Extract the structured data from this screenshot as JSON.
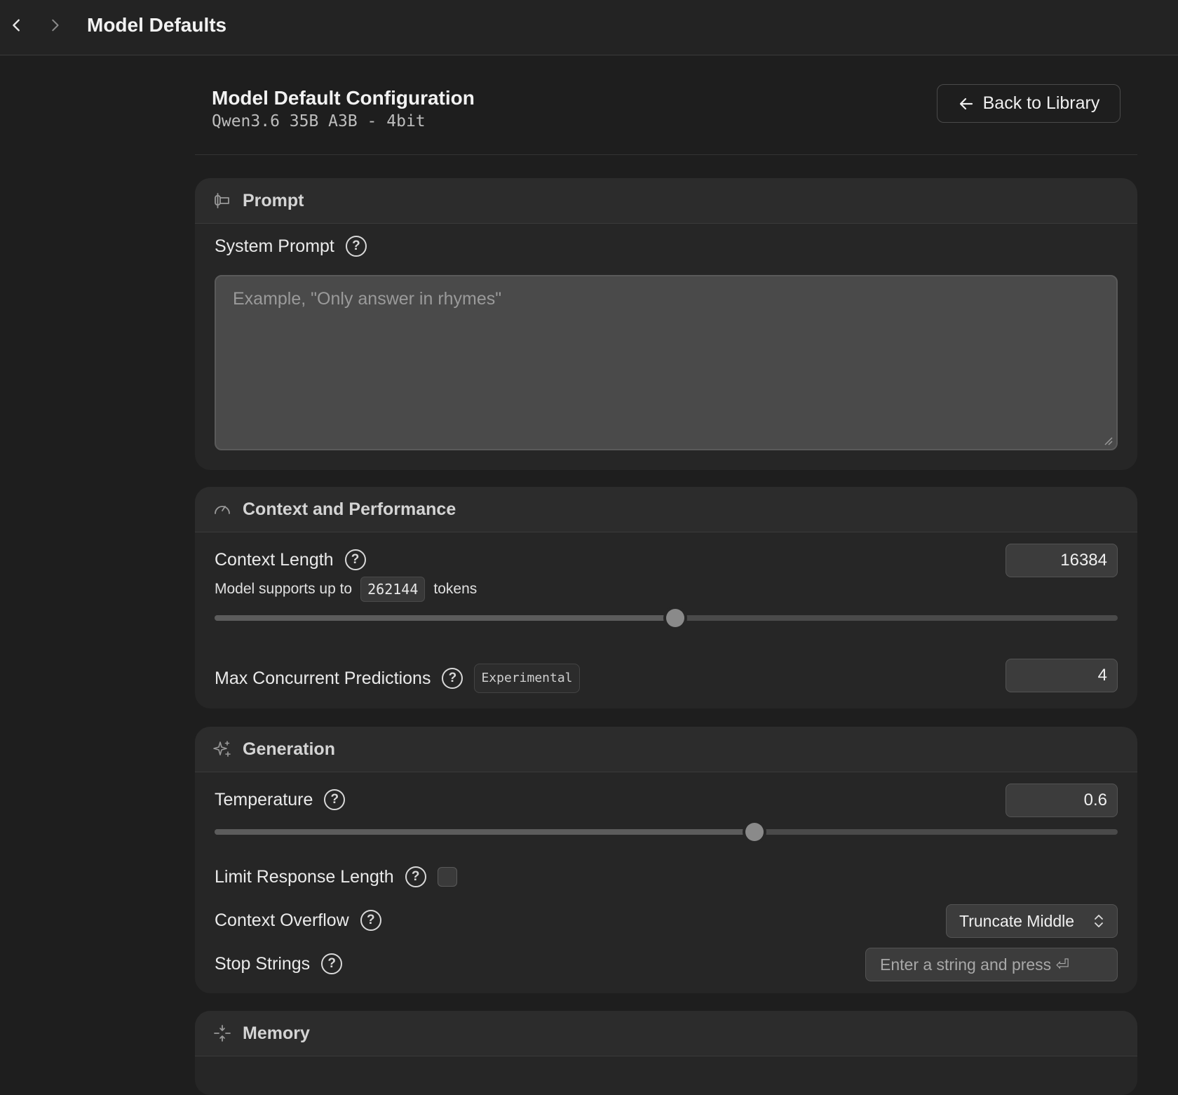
{
  "topbar": {
    "title": "Model Defaults",
    "back_icon": "chevron-left-icon",
    "forward_icon": "chevron-right-icon"
  },
  "header": {
    "title": "Model Default Configuration",
    "model": "Qwen3.6 35B A3B - 4bit",
    "back_button": "Back to Library"
  },
  "prompt_section": {
    "title": "Prompt",
    "system_prompt_label": "System Prompt",
    "system_prompt_value": "",
    "system_prompt_placeholder": "Example, \"Only answer in rhymes\""
  },
  "context_section": {
    "title": "Context and Performance",
    "context_length_label": "Context Length",
    "context_length_value": "16384",
    "supports_prefix": "Model supports up to",
    "supports_max": "262144",
    "supports_suffix": "tokens",
    "context_slider_fraction": 0.51,
    "max_concurrent_label": "Max Concurrent Predictions",
    "experimental_badge": "Experimental",
    "max_concurrent_value": "4"
  },
  "generation_section": {
    "title": "Generation",
    "temperature_label": "Temperature",
    "temperature_value": "0.6",
    "temperature_slider_fraction": 0.598,
    "limit_response_label": "Limit Response Length",
    "limit_response_checked": false,
    "context_overflow_label": "Context Overflow",
    "context_overflow_value": "Truncate Middle",
    "stop_strings_label": "Stop Strings",
    "stop_strings_placeholder": "Enter a string and press ⏎"
  },
  "memory_section": {
    "title": "Memory"
  },
  "colors": {
    "background": "#1e1e1e",
    "card": "#262626",
    "card_header": "#2c2c2c",
    "input": "#3c3c3c",
    "textarea": "#4a4a4a"
  }
}
